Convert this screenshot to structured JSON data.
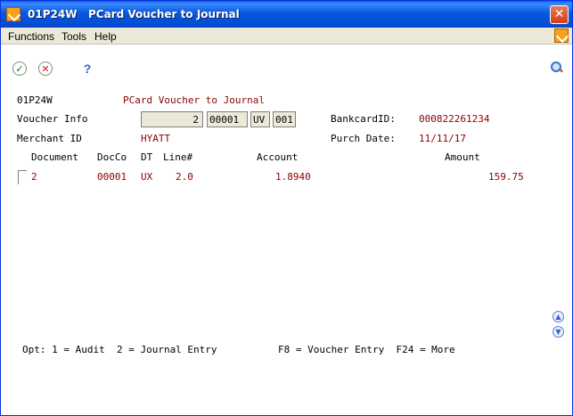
{
  "window": {
    "title": "01P24W   PCard Voucher to Journal",
    "close_glyph": "✕"
  },
  "menu": {
    "items": [
      "Functions",
      "Tools",
      "Help"
    ]
  },
  "toolbar": {
    "ok_glyph": "✓",
    "cancel_glyph": "✕",
    "help_glyph": "?"
  },
  "form": {
    "program_id": "01P24W",
    "form_title": "PCard Voucher to Journal",
    "voucher_info_label": "Voucher Info",
    "voucher_number": "2",
    "voucher_company": "00001",
    "voucher_doc_type": "UV",
    "voucher_line": "001",
    "bankcard_label": "BankcardID:",
    "bankcard_id": "000822261234",
    "merchant_label": "Merchant ID",
    "merchant_id": "HYATT",
    "purch_date_label": "Purch Date:",
    "purch_date": "11/11/17"
  },
  "grid": {
    "headers": {
      "document": "Document",
      "docco": "DocCo",
      "dt": "DT",
      "line": "Line#",
      "account": "Account",
      "amount": "Amount"
    },
    "rows": [
      {
        "document": "2",
        "docco": "00001",
        "dt": "UX",
        "line": "2.0",
        "account": "1.8940",
        "amount": "159.75"
      }
    ]
  },
  "footer": {
    "options": "Opt: 1 = Audit  2 = Journal Entry",
    "fkeys": "F8 = Voucher Entry  F24 = More"
  },
  "scroll": {
    "up_glyph": "▲",
    "down_glyph": "▼"
  }
}
